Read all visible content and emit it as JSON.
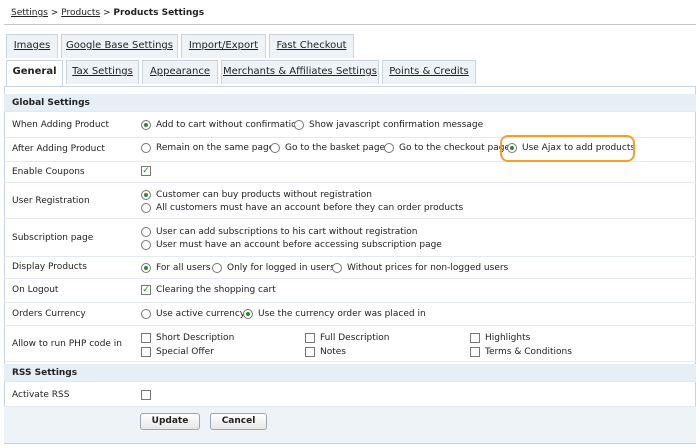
{
  "breadcrumb": {
    "settings": "Settings",
    "sep": ">",
    "products": "Products",
    "current": "Products Settings"
  },
  "tabs_top": [
    "Images",
    "Google Base Settings",
    "Import/Export",
    "Fast Checkout"
  ],
  "tabs_bottom": [
    "General",
    "Tax Settings",
    "Appearance",
    "Merchants & Affiliates Settings",
    "Points & Credits"
  ],
  "global": {
    "title": "Global Settings",
    "when_adding": {
      "label": "When Adding Product",
      "options": [
        "Add to cart without confirmation",
        "Show javascript confirmation message"
      ]
    },
    "after_adding": {
      "label": "After Adding Product",
      "options": [
        "Remain on the same page",
        "Go to the basket page",
        "Go to the checkout page",
        "Use Ajax to add products"
      ]
    },
    "coupons": {
      "label": "Enable Coupons"
    },
    "registration": {
      "label": "User Registration",
      "options": [
        "Customer can buy products without registration",
        "All customers must have an account before they can order products"
      ]
    },
    "subscription": {
      "label": "Subscription page",
      "options": [
        "User can add subscriptions to his cart without registration",
        "User must have an account before accessing subscription page"
      ]
    },
    "display": {
      "label": "Display Products",
      "options": [
        "For all users",
        "Only for logged in users",
        "Without prices for non-logged users"
      ]
    },
    "logout": {
      "label": "On Logout",
      "option": "Clearing the shopping cart"
    },
    "currency": {
      "label": "Orders Currency",
      "options": [
        "Use active currency",
        "Use the currency order was placed in"
      ]
    },
    "php": {
      "label": "Allow to run PHP code in",
      "options": [
        "Short Description",
        "Full Description",
        "Highlights",
        "Special Offer",
        "Notes",
        "Terms & Conditions"
      ]
    }
  },
  "rss": {
    "title": "RSS Settings",
    "activate": {
      "label": "Activate RSS"
    }
  },
  "buttons": {
    "update": "Update",
    "cancel": "Cancel"
  }
}
